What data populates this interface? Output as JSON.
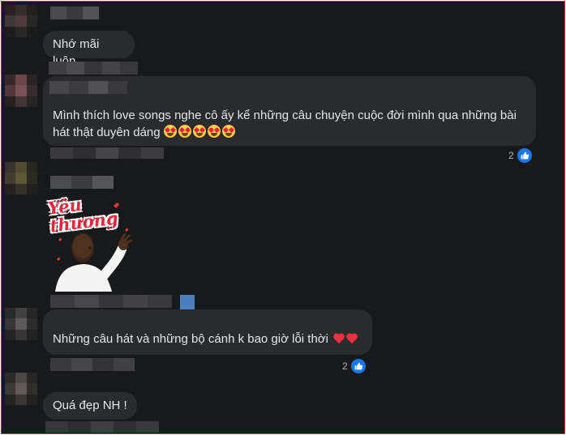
{
  "comments": [
    {
      "id": "c1",
      "text": "Nhớ mãi luôn"
    },
    {
      "id": "c2",
      "text": "Mình thích love songs nghe cô ấy kể những câu chuyện cuộc đời mình qua những bài hát thật duyên dáng",
      "emoji_count": 5,
      "emoji": "star-struck-face",
      "reaction_count": "2",
      "reaction_type": "like"
    },
    {
      "id": "c3",
      "sticker_text": "Yêu thương",
      "sticker": "person-blowing-kiss-with-hearts"
    },
    {
      "id": "c4",
      "text": "Những câu hát và những bộ cánh k bao giờ lỗi thời",
      "emoji_count": 2,
      "emoji": "red-heart",
      "reaction_count": "2",
      "reaction_type": "like"
    },
    {
      "id": "c5",
      "text": "Quá đẹp NH !"
    }
  ],
  "colors": {
    "background": "#18191a",
    "bubble": "#2a2b2d",
    "text": "#e4e6eb",
    "secondary_text": "#b0b3b8",
    "like_blue": "#1877f2",
    "frame_border": "#e0272a"
  }
}
